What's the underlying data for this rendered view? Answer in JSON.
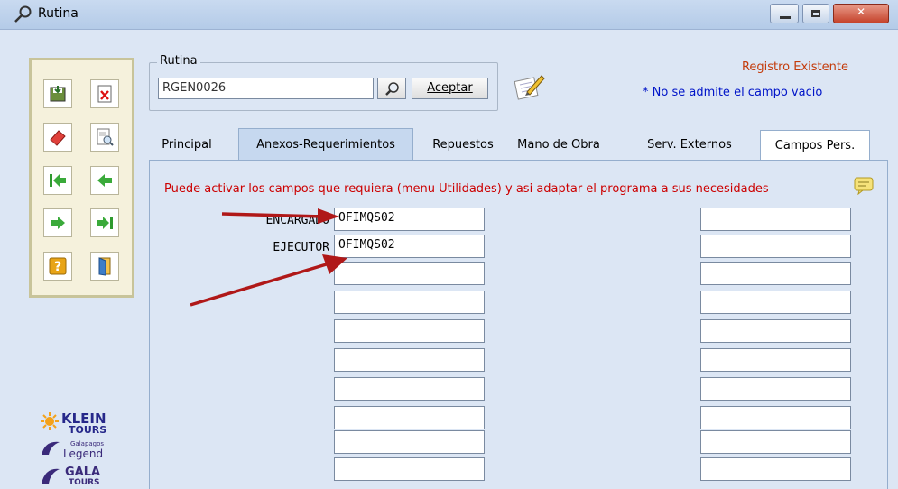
{
  "window": {
    "title": "Rutina"
  },
  "rutina": {
    "group_label": "Rutina",
    "code_value": "RGEN0026",
    "accept_label": "Aceptar"
  },
  "status": {
    "registro": "Registro Existente",
    "no_vacio": "* No se admite el campo vacio"
  },
  "tabs": [
    {
      "label": "Principal"
    },
    {
      "label": "Anexos-Requerimientos"
    },
    {
      "label": "Repuestos"
    },
    {
      "label": "Mano de Obra"
    },
    {
      "label": "Serv. Externos"
    },
    {
      "label": "Campos Pers."
    }
  ],
  "panel": {
    "hint": "Puede activar los campos que requiera (menu Utilidades) y asi adaptar el programa a sus necesidades",
    "fields": [
      {
        "label": "ENCARGADO",
        "value": "OFIMQS02"
      },
      {
        "label": "EJECUTOR",
        "value": "OFIMQS02"
      }
    ]
  },
  "logos": {
    "klein": "KLEIN",
    "tours": "TOURS",
    "galapagos": "Galapagos",
    "legend": "Legend",
    "gala": "GALA",
    "gala_tours": "TOURS"
  },
  "colors": {
    "hint_red": "#cc0000",
    "registro_orange": "#c43c0c",
    "novacio_blue": "#0014c8",
    "arrow_red": "#b01818"
  }
}
